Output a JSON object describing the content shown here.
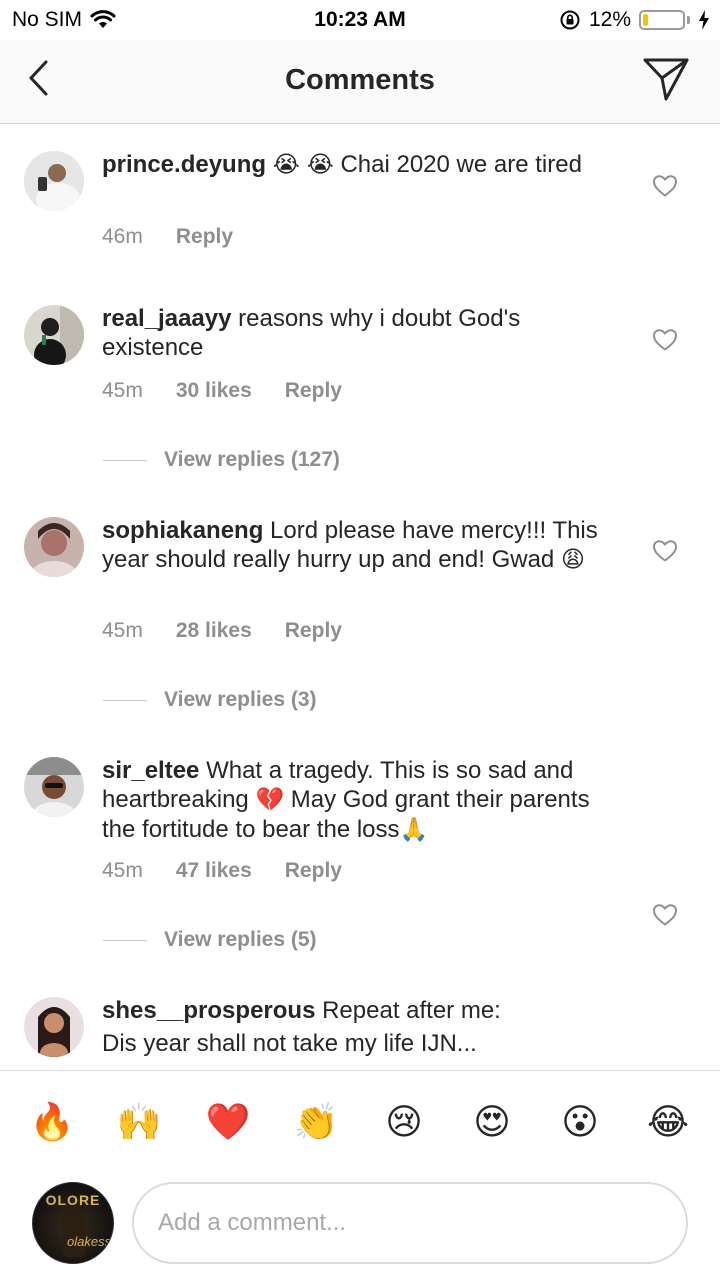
{
  "status": {
    "carrier": "No SIM",
    "time": "10:23 AM",
    "battery_percent": "12%",
    "battery_level": 0.12
  },
  "header": {
    "title": "Comments"
  },
  "comments": [
    {
      "username": "prince.deyung",
      "emoji": "😭 😭",
      "text": "Chai 2020 we are tired",
      "time": "46m",
      "likes": "",
      "reply_label": "Reply"
    },
    {
      "username": "real_jaaayy",
      "text": "reasons why i doubt God's existence",
      "time": "45m",
      "likes": "30 likes",
      "reply_label": "Reply",
      "view_replies": "View replies (127)"
    },
    {
      "username": "sophiakaneng",
      "text": "Lord please have mercy!!! This year should really hurry up and end! Gwad",
      "emoji": "😩",
      "time": "45m",
      "likes": "28 likes",
      "reply_label": "Reply",
      "view_replies": "View replies (3)"
    },
    {
      "username": "sir_eltee",
      "text": "What a tragedy. This is so sad and heartbreaking",
      "emoji": "💔",
      "text2": "May God grant their parents the fortitude to bear the loss",
      "emoji2": "🙏",
      "time": "45m",
      "likes": "47 likes",
      "reply_label": "Reply",
      "view_replies": "View replies (5)"
    },
    {
      "username": "shes__prosperous",
      "text": "Repeat after me:",
      "text2": "Dis year shall not take my life IJN..."
    }
  ],
  "quick_emojis": [
    "🔥",
    "🙌",
    "❤️",
    "👏",
    "😢",
    "😍",
    "😮",
    "😂"
  ],
  "composer": {
    "placeholder": "Add a comment...",
    "avatar_brand": "OLORE",
    "avatar_script": "olakess"
  }
}
